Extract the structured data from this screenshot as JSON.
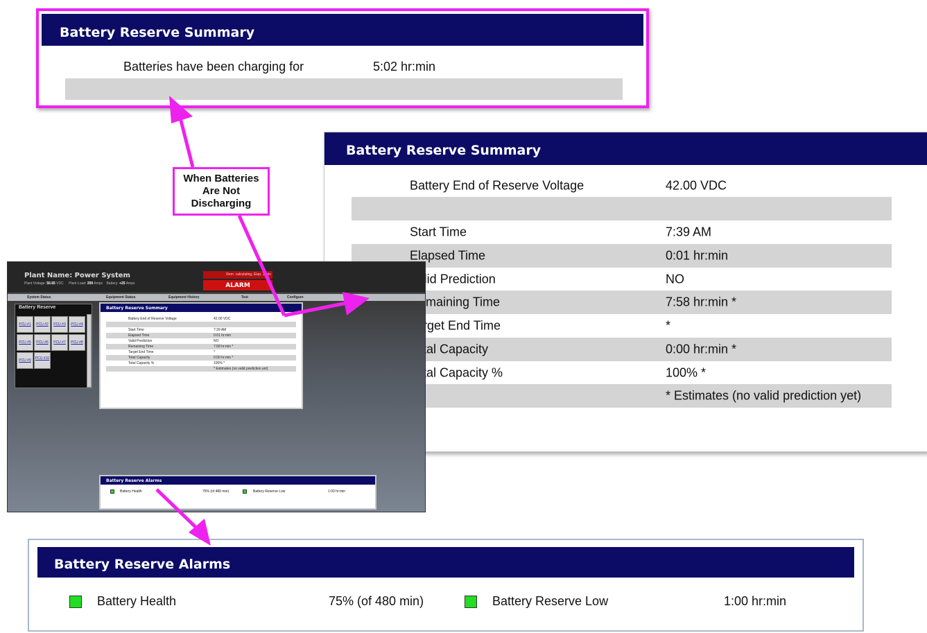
{
  "callout": {
    "line1": "When Batteries",
    "line2": "Are Not",
    "line3": "Discharging"
  },
  "top_panel": {
    "title": "Battery Reserve Summary",
    "label": "Batteries have been charging for",
    "value": "5:02 hr:min"
  },
  "summary_panel": {
    "title": "Battery Reserve Summary",
    "rows": [
      {
        "label": "Battery End of Reserve Voltage",
        "value": "42.00 VDC"
      },
      {
        "label": "",
        "value": ""
      },
      {
        "label": "Start Time",
        "value": "7:39 AM"
      },
      {
        "label": "Elapsed Time",
        "value": "0:01 hr:min"
      },
      {
        "label": "Valid Prediction",
        "value": "NO"
      },
      {
        "label": "Remaining Time",
        "value": "7:58 hr:min *"
      },
      {
        "label": "Target End Time",
        "value": "*"
      },
      {
        "label": "Total Capacity",
        "value": "0:00 hr:min *"
      },
      {
        "label": "Total Capacity %",
        "value": "100% *"
      },
      {
        "label": "",
        "value": "* Estimates (no valid prediction yet)"
      }
    ]
  },
  "alarms_panel": {
    "title": "Battery Reserve Alarms",
    "items": [
      {
        "label": "Battery Health",
        "value": "75% (of 480 min)",
        "status_color": "#22dd22"
      },
      {
        "label": "Battery Reserve Low",
        "value": "1:00 hr:min",
        "status_color": "#22dd22"
      }
    ]
  },
  "screenshot": {
    "plant_name": "Plant Name: Power System",
    "plant_voltage_label": "Plant Voltage:",
    "plant_voltage": "50.65",
    "volt_unit": "VDC",
    "plant_load_label": "Plant Load:",
    "plant_load": "200",
    "amps_unit": "Amps",
    "battery_label": "Battery:",
    "battery_value": "+25",
    "battery_unit": "Amps",
    "status_message": "Rem. calculating, Elap. 1 min",
    "alarm_label": "ALARM",
    "nav": [
      "System Status",
      "Equipment Status",
      "Equipment History",
      "Test",
      "Configure"
    ],
    "left_title": "Battery Reserve",
    "pcus": [
      "PCU #1",
      "PCU #2",
      "PCU #3",
      "PCU #4",
      "PCU #5",
      "PCU #6",
      "PCU #7",
      "PCU #8",
      "PCU #9",
      "PCU #10"
    ],
    "summary_title": "Battery Reserve Summary",
    "alarms_title": "Battery Reserve Alarms"
  },
  "colors": {
    "header_bg": "#0c0c66",
    "accent_magenta": "#ee22ee",
    "alarm_red": "#cc1111",
    "ok_green": "#22dd22"
  }
}
